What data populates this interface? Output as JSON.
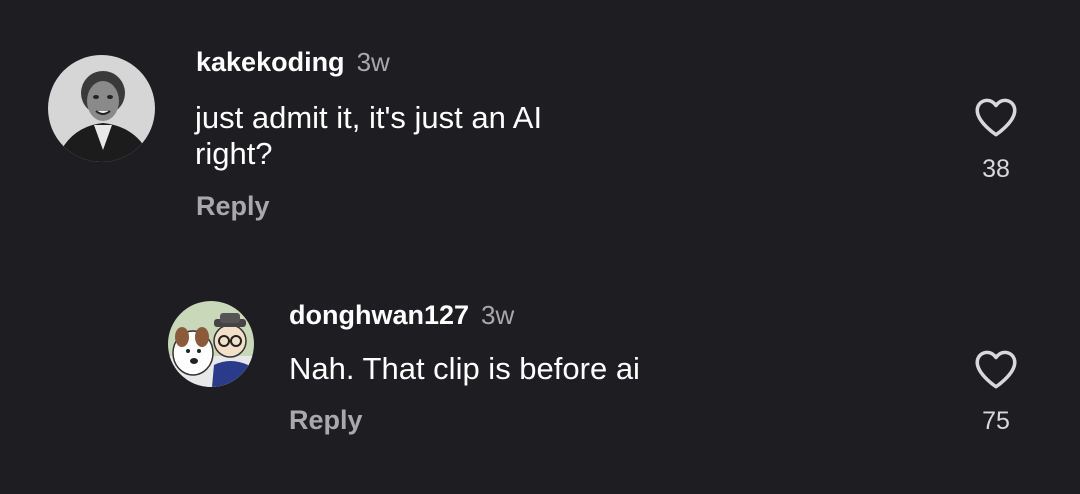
{
  "comments": [
    {
      "username": "kakekoding",
      "timestamp": "3w",
      "text_line1": "just admit it, it's just an AI",
      "text_line2": "right?",
      "reply_label": "Reply",
      "like_count": "38",
      "like_icon": "heart-outline-icon"
    },
    {
      "username": "donghwan127",
      "timestamp": "3w",
      "text_line1": "Nah. That clip is before ai",
      "reply_label": "Reply",
      "like_count": "75",
      "like_icon": "heart-outline-icon"
    }
  ],
  "colors": {
    "background": "#1e1e22",
    "primary_text": "#ffffff",
    "secondary_text": "#a8a8ad"
  }
}
